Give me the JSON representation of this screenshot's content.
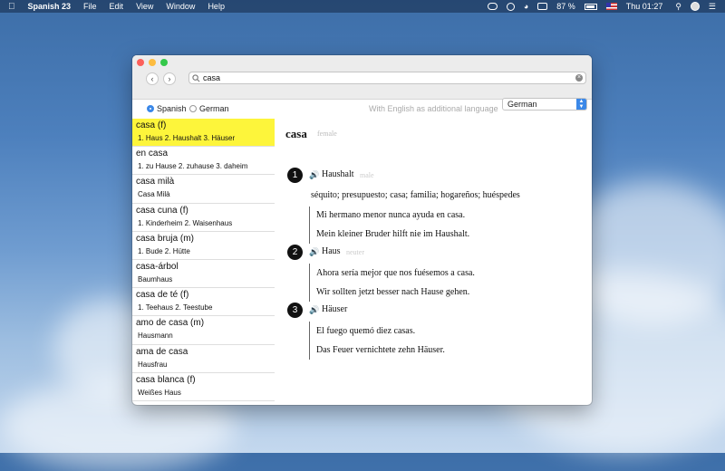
{
  "menubar": {
    "app_name": "Spanish 23",
    "menus": [
      "File",
      "Edit",
      "View",
      "Window",
      "Help"
    ],
    "battery": "87 %",
    "clock": "Thu 01:27"
  },
  "window": {
    "search": {
      "value": "casa"
    },
    "languages": [
      {
        "label": "Spanish",
        "selected": true
      },
      {
        "label": "German",
        "selected": false
      }
    ],
    "additional_language_label": "With English as additional language",
    "additional_language_value": "German",
    "results": [
      {
        "word": "casa (f)",
        "translation": "1. Haus 2. Haushalt 3. Häuser",
        "selected": true
      },
      {
        "word": "en casa",
        "translation": "1. zu Hause 2. zuhause 3. daheim"
      },
      {
        "word": "casa milà",
        "translation": "Casa Milà"
      },
      {
        "word": "casa cuna (f)",
        "translation": "1. Kinderheim 2. Waisenhaus"
      },
      {
        "word": "casa bruja (m)",
        "translation": "1. Bude 2. Hütte"
      },
      {
        "word": "casa-árbol",
        "translation": "Baumhaus"
      },
      {
        "word": "casa de té (f)",
        "translation": "1. Teehaus 2. Teestube"
      },
      {
        "word": "amo de casa (m)",
        "translation": "Hausmann"
      },
      {
        "word": "ama de casa",
        "translation": "Hausfrau"
      },
      {
        "word": "casa blanca (f)",
        "translation": "Weißes Haus"
      }
    ],
    "entry": {
      "headword": "casa",
      "gender": "female",
      "senses": [
        {
          "number": "1",
          "word": "Haushalt",
          "gender": "male",
          "synonyms": "séquito; presupuesto; casa; familia; hogareños; huéspedes",
          "examples": [
            "Mi hermano menor nunca ayuda en casa.",
            "Mein kleiner Bruder hilft nie im Haushalt."
          ]
        },
        {
          "number": "2",
          "word": "Haus",
          "gender": "neuter",
          "examples": [
            "Ahora sería mejor que nos fuésemos a casa.",
            "Wir sollten jetzt besser nach Hause gehen."
          ]
        },
        {
          "number": "3",
          "word": "Häuser",
          "examples": [
            "El fuego quemó diez casas.",
            "Das Feuer vernichtete zehn Häuser."
          ]
        }
      ]
    }
  },
  "colors": {
    "selection": "#fdf53b",
    "accent": "#3b88e8",
    "close": "#fc605b",
    "minimize": "#fdbc40",
    "zoom": "#34c84a"
  },
  "icons": {
    "apple": "apple-icon",
    "search": "search-icon",
    "clear": "clear-icon",
    "speaker": "speaker-icon"
  }
}
